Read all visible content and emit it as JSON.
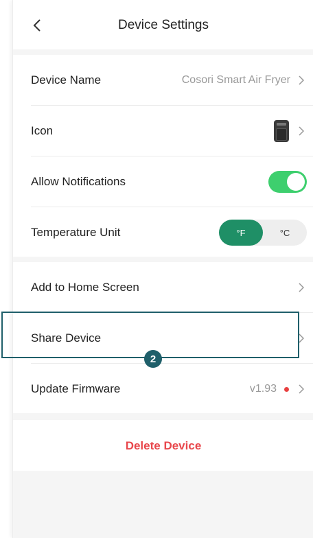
{
  "header": {
    "title": "Device Settings"
  },
  "settings": {
    "device_name": {
      "label": "Device Name",
      "value": "Cosori Smart Air Fryer"
    },
    "icon": {
      "label": "Icon"
    },
    "notifications": {
      "label": "Allow Notifications",
      "enabled": true
    },
    "temperature": {
      "label": "Temperature Unit",
      "options": [
        "°F",
        "°C"
      ],
      "selected": "°F"
    }
  },
  "actions": {
    "add_home": {
      "label": "Add to Home Screen"
    },
    "share": {
      "label": "Share Device"
    },
    "firmware": {
      "label": "Update Firmware",
      "version": "v1.93"
    }
  },
  "annotation": {
    "step": "2"
  },
  "delete": {
    "label": "Delete Device"
  },
  "colors": {
    "toggle_on": "#3ecf6e",
    "unit_selected": "#1f8f66",
    "highlight": "#1f5f6a",
    "delete": "#e8474c",
    "update_dot": "#e84141"
  }
}
